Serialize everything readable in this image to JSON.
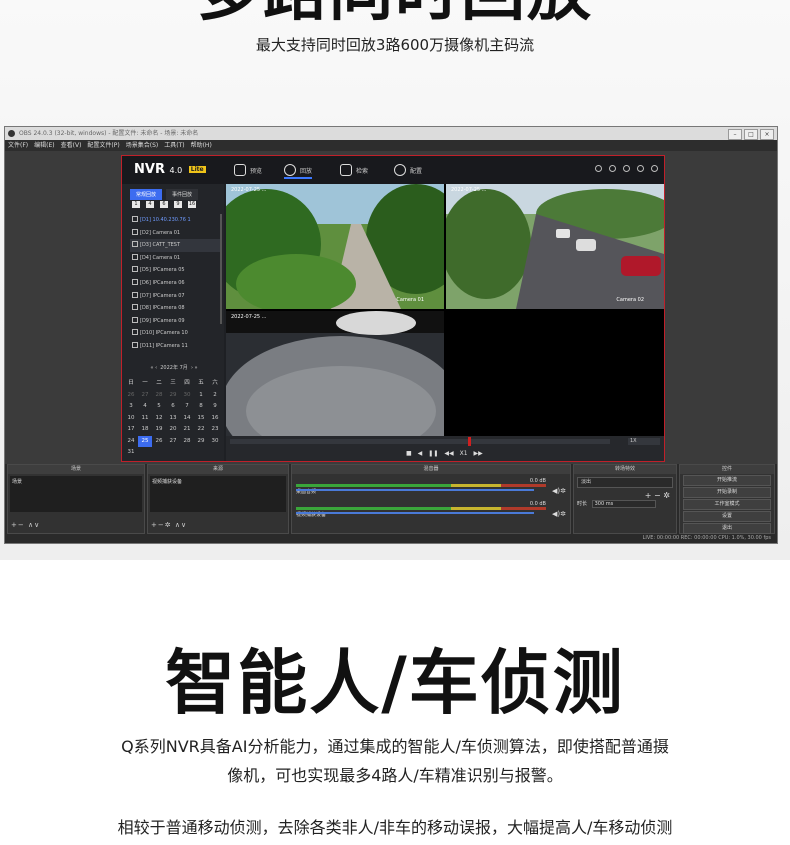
{
  "section1": {
    "heading": "多路同时回放",
    "subtitle": "最大支持同时回放3路600万摄像机主码流"
  },
  "obs": {
    "title": "OBS 24.0.3 (32-bit, windows) - 配置文件: 未命名 - 场景: 未命名",
    "menu": [
      "文件(F)",
      "编辑(E)",
      "查看(V)",
      "配置文件(P)",
      "场景集合(S)",
      "工具(T)",
      "帮助(H)"
    ],
    "status": "LIVE: 00:00:00    REC: 00:00:00    CPU: 1.0%, 30.00 fps"
  },
  "nvr": {
    "logo": "NVR",
    "version": "4.0",
    "badge": "Lite",
    "tabs": [
      "预览",
      "回放",
      "检索",
      "配置"
    ],
    "side_tabs": [
      "常规回放",
      "事件回放"
    ],
    "side_buttons": [
      "1",
      "4",
      "6",
      "9",
      "16"
    ],
    "cameras": [
      "[D1] 10.40.230.76 1",
      "[D2] Camera 01",
      "[D3] CATT_TEST",
      "[D4] Camera 01",
      "[D5] IPCamera 05",
      "[D6] IPCamera 06",
      "[D7] IPCamera 07",
      "[D8] IPCamera 08",
      "[D9] IPCamera 09",
      "[D10] IPCamera 10",
      "[D11] IPCamera 11"
    ],
    "calendar_title": "2022年 7月",
    "weekdays": [
      "日",
      "一",
      "二",
      "三",
      "四",
      "五",
      "六"
    ],
    "days": [
      "26",
      "27",
      "28",
      "29",
      "30",
      "1",
      "2",
      "3",
      "4",
      "5",
      "6",
      "7",
      "8",
      "9",
      "10",
      "11",
      "12",
      "13",
      "14",
      "15",
      "16",
      "17",
      "18",
      "19",
      "20",
      "21",
      "22",
      "23",
      "24",
      "25",
      "26",
      "27",
      "28",
      "29",
      "30",
      "31"
    ],
    "today": "25",
    "cells": [
      {
        "ts": "2022-07-25 ...",
        "name": "Camera 01"
      },
      {
        "ts": "2022-07-25 ...",
        "name": "Camera 02"
      },
      {
        "ts": "2022-07-25 ...",
        "name": ""
      },
      {
        "ts": "",
        "name": ""
      }
    ],
    "speed": "1X",
    "playback_speed": "X1"
  },
  "dock": {
    "scenes_title": "场景",
    "scene_item": "场景",
    "sources_title": "来源",
    "source_item": "视频捕获设备",
    "mixer_title": "混音器",
    "mixer": [
      {
        "name": "桌面音频",
        "db": "0.0 dB"
      },
      {
        "name": "视频捕获设备",
        "db": "0.0 dB"
      }
    ],
    "transitions_title": "转场特效",
    "transition": "淡出",
    "duration_label": "时长",
    "duration": "300 ms",
    "controls_title": "控件",
    "controls": [
      "开始推流",
      "开始录制",
      "工作室模式",
      "设置",
      "退出"
    ]
  },
  "section2": {
    "heading": "智能人/车侦测",
    "para1_line1": "Q系列NVR具备AI分析能力，通过集成的智能人/车侦测算法，即使搭配普通摄",
    "para1_line2": "像机，可也实现最多4路人/车精准识别与报警。",
    "para2": "相较于普通移动侦测，去除各类非人/非车的移动误报，大幅提高人/车移动侦测"
  }
}
